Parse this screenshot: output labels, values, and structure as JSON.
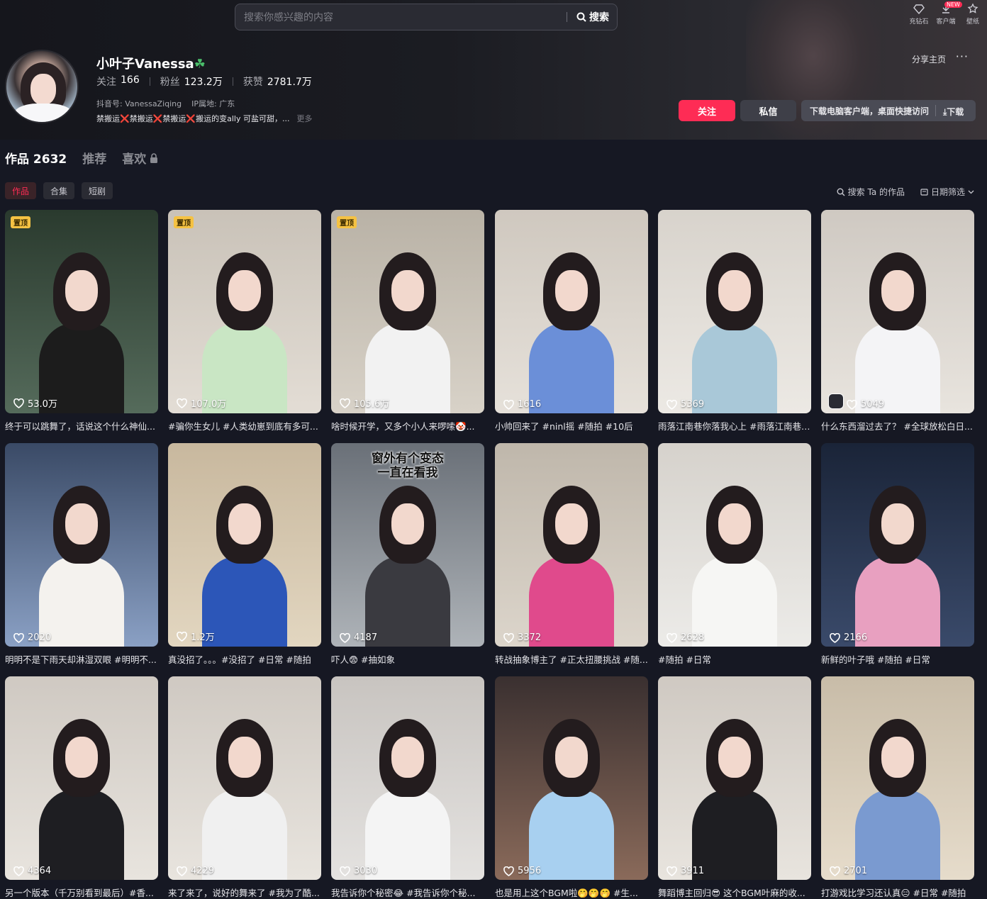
{
  "search": {
    "placeholder": "搜索你感兴趣的内容",
    "button_label": "搜索"
  },
  "top_icons": [
    {
      "label": "充钻石",
      "icon": "diamond-icon"
    },
    {
      "label": "客户端",
      "icon": "download-icon",
      "badge": "NEW"
    },
    {
      "label": "壁纸",
      "icon": "wallpaper-icon"
    }
  ],
  "profile": {
    "name": "小叶子Vanessa",
    "name_emoji": "☘",
    "following_label": "关注",
    "following": "166",
    "followers_label": "粉丝",
    "followers": "123.2万",
    "likes_label": "获赞",
    "likes": "2781.7万",
    "douyin_id": "抖音号: VanessaZiqing",
    "ip": "IP属地: 广东",
    "bio": "禁搬运❌禁搬运❌禁搬运❌搬运的变ally 可盐可甜，...",
    "bio_more": "更多"
  },
  "actions": {
    "share": "分享主页",
    "more": "···",
    "follow": "关注",
    "message": "私信",
    "download_text": "下载电脑客户端，桌面快捷访问",
    "download_btn": "⤓下载"
  },
  "tabs": [
    {
      "label": "作品 2632",
      "active": true
    },
    {
      "label": "推荐",
      "active": false
    },
    {
      "label": "喜欢",
      "active": false,
      "locked": true
    }
  ],
  "subtabs": [
    {
      "label": "作品",
      "active": true
    },
    {
      "label": "合集",
      "active": false
    },
    {
      "label": "短剧",
      "active": false
    }
  ],
  "tools": {
    "search_works": "搜索 Ta 的作品",
    "date_filter": "日期筛选"
  },
  "pin_label": "置顶",
  "videos": [
    {
      "likes": "53.0万",
      "caption": "终于可以跳舞了，话说这个什么神仙...",
      "pinned": true,
      "bg": [
        "#2a3a2e",
        "#556b5b"
      ],
      "shirt": "#1c1c1c"
    },
    {
      "likes": "107.0万",
      "caption": "#骗你生女儿 #人类幼崽到底有多可...",
      "pinned": true,
      "bg": [
        "#c9c2b8",
        "#e3ddd5"
      ],
      "shirt": "#c9e6c4"
    },
    {
      "likes": "105.6万",
      "caption": "啥时候开学，又多个小人来啰嗦🤡...",
      "pinned": true,
      "bg": [
        "#b9b2a6",
        "#d8d2c8"
      ],
      "shirt": "#f2f2f2"
    },
    {
      "likes": "1616",
      "caption": "小帅回来了 #ninl摇 #随拍 #10后",
      "pinned": false,
      "bg": [
        "#cfc8bf",
        "#e6e1da"
      ],
      "shirt": "#6b8fd8"
    },
    {
      "likes": "5369",
      "caption": "雨落江南巷你落我心上 #雨落江南巷 ...",
      "pinned": false,
      "bg": [
        "#d8d3cc",
        "#ece9e4"
      ],
      "shirt": "#a9c8d8"
    },
    {
      "likes": "5049",
      "caption": "什么东西溜过去了？ #全球放松白日...",
      "pinned": false,
      "bg": [
        "#cfc9c2",
        "#e8e4de"
      ],
      "shirt": "#f4f4f6",
      "special": true
    },
    {
      "likes": "2020",
      "caption": "明明不是下雨天却淋湿双眼 #明明不...",
      "pinned": false,
      "bg": [
        "#3a4a66",
        "#8aa0c4"
      ],
      "shirt": "#f4f2ee"
    },
    {
      "likes": "1.2万",
      "caption": "真没招了。。。#没招了 #日常 #随拍",
      "pinned": false,
      "bg": [
        "#c8b89e",
        "#e2d6c0"
      ],
      "shirt": "#2c56b8"
    },
    {
      "likes": "4187",
      "caption": "吓人😨 #抽如象",
      "pinned": false,
      "bg": [
        "#6a7078",
        "#aeb3b8"
      ],
      "shirt": "#3a3a40",
      "overlay": "窗外有个变态\n一直在看我"
    },
    {
      "likes": "3372",
      "caption": "转战抽象博主了 #正太扭腰挑战 #随...",
      "pinned": false,
      "bg": [
        "#bfb7ab",
        "#dcd5cb"
      ],
      "shirt": "#e04a8c"
    },
    {
      "likes": "2628",
      "caption": "#随拍 #日常",
      "pinned": false,
      "bg": [
        "#d6d2cc",
        "#ecebe8"
      ],
      "shirt": "#f6f6f4"
    },
    {
      "likes": "2166",
      "caption": "新鲜的叶子哦 #随拍 #日常",
      "pinned": false,
      "bg": [
        "#1a2438",
        "#3a4a6a"
      ],
      "shirt": "#e8a0c0"
    },
    {
      "likes": "4364",
      "caption": "另一个版本（千万别看到最后）#香...",
      "pinned": false,
      "bg": [
        "#cfc9c2",
        "#e8e4de"
      ],
      "shirt": "#1e1e22"
    },
    {
      "likes": "4229",
      "caption": "来了来了，说好的舞来了 #我为了酷...",
      "pinned": false,
      "bg": [
        "#cfc9c2",
        "#e8e4de"
      ],
      "shirt": "#f0f0f0"
    },
    {
      "likes": "3030",
      "caption": "我告诉你个秘密😂 #我告诉你个秘...",
      "pinned": false,
      "bg": [
        "#c8c4c0",
        "#e4e2e0"
      ],
      "shirt": "#f4f4f4"
    },
    {
      "likes": "5956",
      "caption": "也是用上这个BGM啦🤭🤭🤭 #生...",
      "pinned": false,
      "bg": [
        "#3a3030",
        "#8a6a5a"
      ],
      "shirt": "#a8d0f0"
    },
    {
      "likes": "3911",
      "caption": "舞蹈博主回归😎 这个BGM叶麻的收...",
      "pinned": false,
      "bg": [
        "#cfc9c2",
        "#e8e4de"
      ],
      "shirt": "#1e1e22"
    },
    {
      "likes": "2701",
      "caption": "打游戏比学习还认真😑 #日常 #随拍",
      "pinned": false,
      "bg": [
        "#c8bca8",
        "#e6dccb"
      ],
      "shirt": "#7a9ad0"
    }
  ]
}
